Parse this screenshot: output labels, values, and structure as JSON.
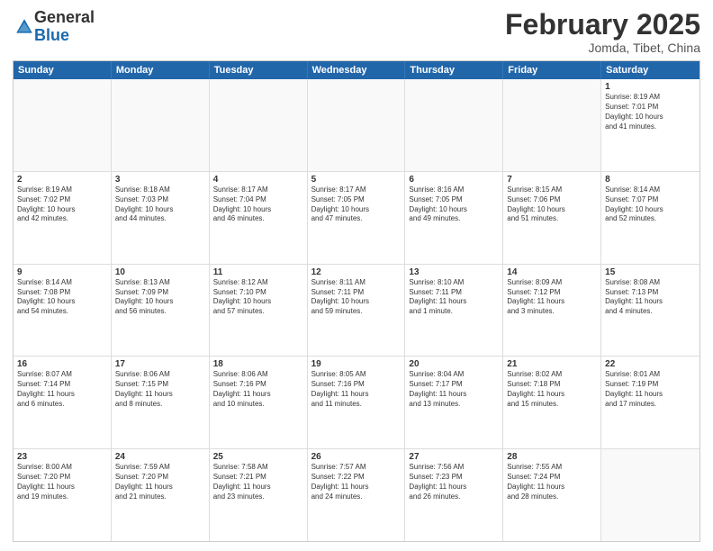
{
  "header": {
    "logo_line1": "General",
    "logo_line2": "Blue",
    "month": "February 2025",
    "location": "Jomda, Tibet, China"
  },
  "weekdays": [
    "Sunday",
    "Monday",
    "Tuesday",
    "Wednesday",
    "Thursday",
    "Friday",
    "Saturday"
  ],
  "weeks": [
    [
      {
        "day": "",
        "text": ""
      },
      {
        "day": "",
        "text": ""
      },
      {
        "day": "",
        "text": ""
      },
      {
        "day": "",
        "text": ""
      },
      {
        "day": "",
        "text": ""
      },
      {
        "day": "",
        "text": ""
      },
      {
        "day": "1",
        "text": "Sunrise: 8:19 AM\nSunset: 7:01 PM\nDaylight: 10 hours\nand 41 minutes."
      }
    ],
    [
      {
        "day": "2",
        "text": "Sunrise: 8:19 AM\nSunset: 7:02 PM\nDaylight: 10 hours\nand 42 minutes."
      },
      {
        "day": "3",
        "text": "Sunrise: 8:18 AM\nSunset: 7:03 PM\nDaylight: 10 hours\nand 44 minutes."
      },
      {
        "day": "4",
        "text": "Sunrise: 8:17 AM\nSunset: 7:04 PM\nDaylight: 10 hours\nand 46 minutes."
      },
      {
        "day": "5",
        "text": "Sunrise: 8:17 AM\nSunset: 7:05 PM\nDaylight: 10 hours\nand 47 minutes."
      },
      {
        "day": "6",
        "text": "Sunrise: 8:16 AM\nSunset: 7:05 PM\nDaylight: 10 hours\nand 49 minutes."
      },
      {
        "day": "7",
        "text": "Sunrise: 8:15 AM\nSunset: 7:06 PM\nDaylight: 10 hours\nand 51 minutes."
      },
      {
        "day": "8",
        "text": "Sunrise: 8:14 AM\nSunset: 7:07 PM\nDaylight: 10 hours\nand 52 minutes."
      }
    ],
    [
      {
        "day": "9",
        "text": "Sunrise: 8:14 AM\nSunset: 7:08 PM\nDaylight: 10 hours\nand 54 minutes."
      },
      {
        "day": "10",
        "text": "Sunrise: 8:13 AM\nSunset: 7:09 PM\nDaylight: 10 hours\nand 56 minutes."
      },
      {
        "day": "11",
        "text": "Sunrise: 8:12 AM\nSunset: 7:10 PM\nDaylight: 10 hours\nand 57 minutes."
      },
      {
        "day": "12",
        "text": "Sunrise: 8:11 AM\nSunset: 7:11 PM\nDaylight: 10 hours\nand 59 minutes."
      },
      {
        "day": "13",
        "text": "Sunrise: 8:10 AM\nSunset: 7:11 PM\nDaylight: 11 hours\nand 1 minute."
      },
      {
        "day": "14",
        "text": "Sunrise: 8:09 AM\nSunset: 7:12 PM\nDaylight: 11 hours\nand 3 minutes."
      },
      {
        "day": "15",
        "text": "Sunrise: 8:08 AM\nSunset: 7:13 PM\nDaylight: 11 hours\nand 4 minutes."
      }
    ],
    [
      {
        "day": "16",
        "text": "Sunrise: 8:07 AM\nSunset: 7:14 PM\nDaylight: 11 hours\nand 6 minutes."
      },
      {
        "day": "17",
        "text": "Sunrise: 8:06 AM\nSunset: 7:15 PM\nDaylight: 11 hours\nand 8 minutes."
      },
      {
        "day": "18",
        "text": "Sunrise: 8:06 AM\nSunset: 7:16 PM\nDaylight: 11 hours\nand 10 minutes."
      },
      {
        "day": "19",
        "text": "Sunrise: 8:05 AM\nSunset: 7:16 PM\nDaylight: 11 hours\nand 11 minutes."
      },
      {
        "day": "20",
        "text": "Sunrise: 8:04 AM\nSunset: 7:17 PM\nDaylight: 11 hours\nand 13 minutes."
      },
      {
        "day": "21",
        "text": "Sunrise: 8:02 AM\nSunset: 7:18 PM\nDaylight: 11 hours\nand 15 minutes."
      },
      {
        "day": "22",
        "text": "Sunrise: 8:01 AM\nSunset: 7:19 PM\nDaylight: 11 hours\nand 17 minutes."
      }
    ],
    [
      {
        "day": "23",
        "text": "Sunrise: 8:00 AM\nSunset: 7:20 PM\nDaylight: 11 hours\nand 19 minutes."
      },
      {
        "day": "24",
        "text": "Sunrise: 7:59 AM\nSunset: 7:20 PM\nDaylight: 11 hours\nand 21 minutes."
      },
      {
        "day": "25",
        "text": "Sunrise: 7:58 AM\nSunset: 7:21 PM\nDaylight: 11 hours\nand 23 minutes."
      },
      {
        "day": "26",
        "text": "Sunrise: 7:57 AM\nSunset: 7:22 PM\nDaylight: 11 hours\nand 24 minutes."
      },
      {
        "day": "27",
        "text": "Sunrise: 7:56 AM\nSunset: 7:23 PM\nDaylight: 11 hours\nand 26 minutes."
      },
      {
        "day": "28",
        "text": "Sunrise: 7:55 AM\nSunset: 7:24 PM\nDaylight: 11 hours\nand 28 minutes."
      },
      {
        "day": "",
        "text": ""
      }
    ]
  ]
}
